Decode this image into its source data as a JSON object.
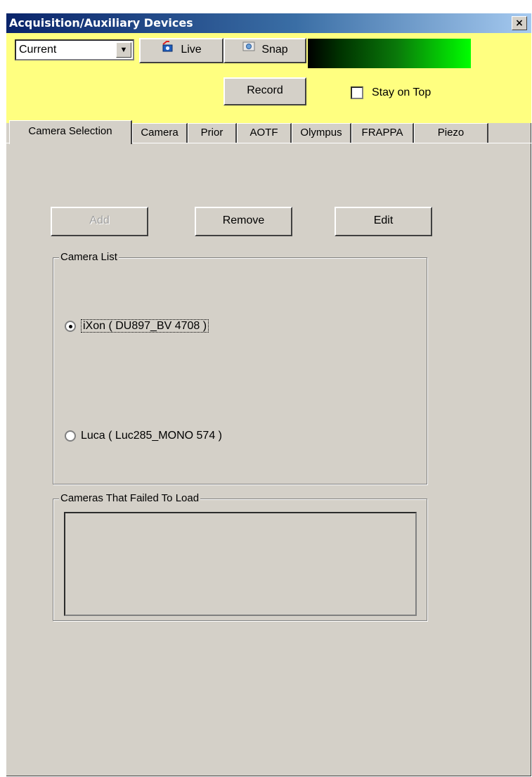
{
  "window": {
    "title": "Acquisition/Auxiliary Devices",
    "close_glyph": "×"
  },
  "toolbar": {
    "mode_select": {
      "value": "Current",
      "arrow": "▼"
    },
    "live_label": "Live",
    "live_icon": "camera-icon",
    "snap_label": "Snap",
    "snap_icon": "snap-icon",
    "record_label": "Record",
    "stay_on_top_label": "Stay on Top",
    "stay_on_top_checked": false
  },
  "tabs": [
    {
      "label": "Camera Selection",
      "active": true
    },
    {
      "label": "Camera",
      "active": false
    },
    {
      "label": "Prior",
      "active": false
    },
    {
      "label": "AOTF",
      "active": false
    },
    {
      "label": "Olympus",
      "active": false
    },
    {
      "label": "FRAPPA",
      "active": false
    },
    {
      "label": "Piezo",
      "active": false
    }
  ],
  "camera_selection": {
    "add_label": "Add",
    "add_enabled": false,
    "remove_label": "Remove",
    "edit_label": "Edit",
    "camera_list": {
      "title": "Camera List",
      "cameras": [
        {
          "label": "iXon ( DU897_BV 4708 )",
          "selected": true
        },
        {
          "label": "Luca ( Luc285_MONO 574 )",
          "selected": false
        }
      ]
    },
    "failed_group": {
      "title": "Cameras That Failed To Load",
      "items": []
    }
  },
  "colors": {
    "toolbar_background": "#ffff80",
    "dialog_background": "#d4d0c8",
    "titlebar_start": "#0a246a",
    "titlebar_end": "#a6caf0",
    "level_bar_end": "#00ff00"
  }
}
